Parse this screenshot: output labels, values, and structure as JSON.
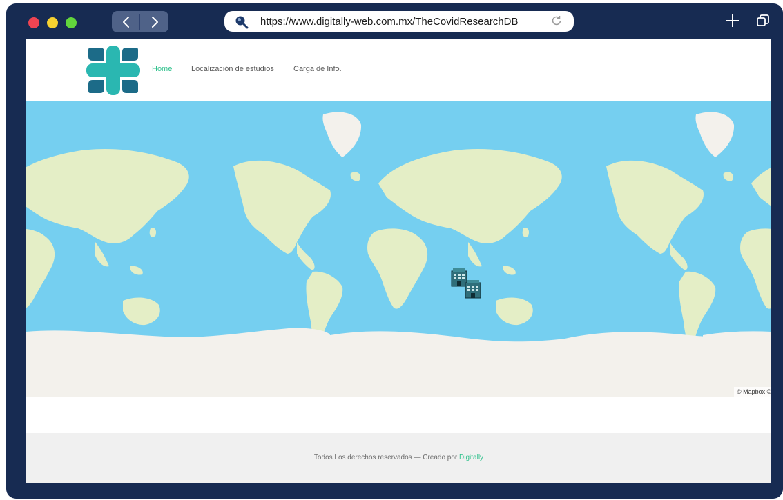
{
  "browser": {
    "url": "https://www.digitally-web.com.mx/TheCovidResearchDB"
  },
  "nav": {
    "items": [
      {
        "label": "Home",
        "active": true
      },
      {
        "label": "Localización de estudios",
        "active": false
      },
      {
        "label": "Carga de Info.",
        "active": false
      }
    ]
  },
  "map": {
    "attribution": "© Mapbox ©",
    "markers": [
      {
        "icon": "building-icon",
        "label": ""
      },
      {
        "icon": "building-icon",
        "label": ""
      }
    ]
  },
  "footer": {
    "text": "Todos Los derechos reservados — Creado por ",
    "link": "Digitally"
  },
  "colors": {
    "frame": "#172b52",
    "accent": "#2fc18c",
    "ocean": "#75cff0",
    "land": "#e4eec6",
    "ice": "#f3f1ec",
    "logo_teal": "#2ab7b1",
    "logo_dark": "#1c6b88"
  }
}
